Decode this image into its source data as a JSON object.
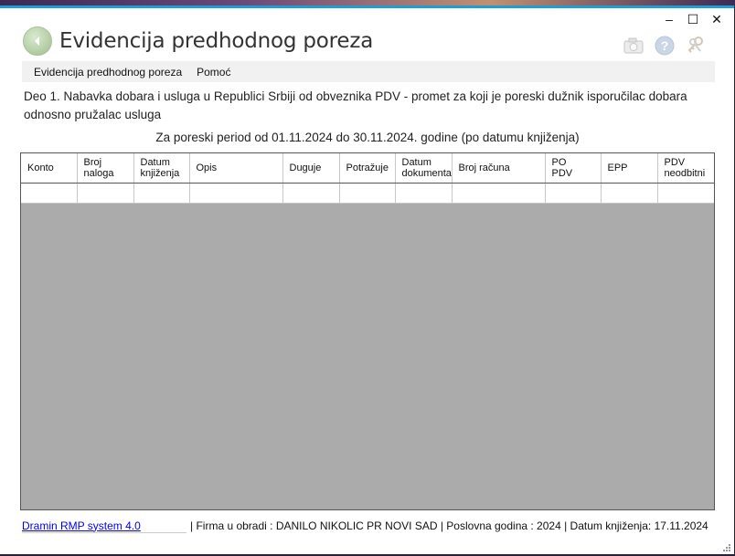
{
  "window": {
    "title": "Evidencija predhodnog poreza"
  },
  "controls": {
    "minimize": "–",
    "maximize": "☐",
    "close": "✕"
  },
  "menu": {
    "items": [
      "Evidencija predhodnog poreza",
      "Pomoć"
    ]
  },
  "description": "Deo 1. Nabavka dobara i usluga u Republici Srbiji od obveznika PDV - promet za koji je poreski dužnik isporučilac dobara odnosno pružalac usluga",
  "period": "Za poreski period od 01.11.2024 do 30.11.2024. godine (po datumu knjiženja)",
  "table": {
    "columns": [
      [
        "Konto"
      ],
      [
        "Broj",
        "naloga"
      ],
      [
        "Datum",
        "knjiženja"
      ],
      [
        "Opis"
      ],
      [
        "Duguje"
      ],
      [
        "Potražuje"
      ],
      [
        "Datum",
        "dokumenta"
      ],
      [
        "Broj računa"
      ],
      [
        "PO",
        "PDV"
      ],
      [
        "EPP"
      ],
      [
        "PDV",
        "neodbitni"
      ]
    ]
  },
  "status": {
    "link": "Dramin RMP system 4.0",
    "text": "| Firma u obradi : DANILO NIKOLIC PR NOVI SAD  |  Poslovna godina : 2024  |  Datum knjiženja: 17.11.2024"
  }
}
